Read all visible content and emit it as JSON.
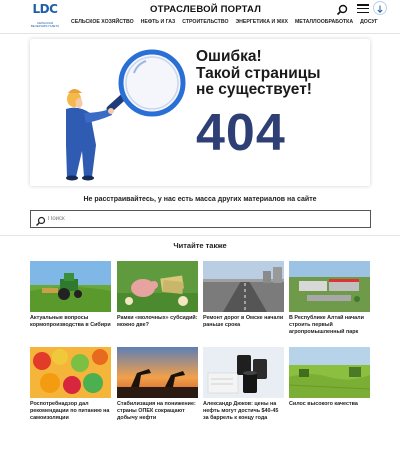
{
  "header": {
    "logo_text": "LDC",
    "logo_sub": "СЕЛЬСКАЯ ВЕЧЕРНЯЯ ГАЗЕТА",
    "title": "ОТРАСЛЕВОЙ ПОРТАЛ",
    "nav": [
      "СЕЛЬСКОЕ ХОЗЯЙСТВО",
      "НЕФТЬ И ГАЗ",
      "СТРОИТЕЛЬСТВО",
      "ЭНЕРГЕТИКА И ЖКХ",
      "МЕТАЛЛООБРАБОТКА",
      "ДОСУГ"
    ],
    "icons": [
      "search-icon",
      "menu-icon",
      "arrow-down-icon"
    ]
  },
  "error": {
    "title": "Ошибка!\nТакой страницы\nне существует!",
    "code": "404"
  },
  "hint": "Не расстраивайтесь, у нас есть масса других материалов на сайте",
  "search": {
    "placeholder": "Поиск"
  },
  "read_also": "Читайте также",
  "articles": [
    {
      "title": "Актуальные вопросы кормопроизводства в Сибири"
    },
    {
      "title": "Рамки «молочных» субсидий: можно две?"
    },
    {
      "title": "Ремонт дорог в Омске начали раньше срока"
    },
    {
      "title": "В Республике Алтай начали строить первый агропромышленный парк"
    },
    {
      "title": "Роспотребнадзор дал рекомендации по питанию на самоизоляции"
    },
    {
      "title": "Стабилизация на понижение: страны ОПЕК сокращают добычу нефти"
    },
    {
      "title": "Александр Дюков: цены на нефть могут достичь $40-45 за баррель к концу года"
    },
    {
      "title": "Силос высокого качества"
    }
  ],
  "colors": {
    "accent": "#2d3f74",
    "brand": "#1e5fa8"
  }
}
